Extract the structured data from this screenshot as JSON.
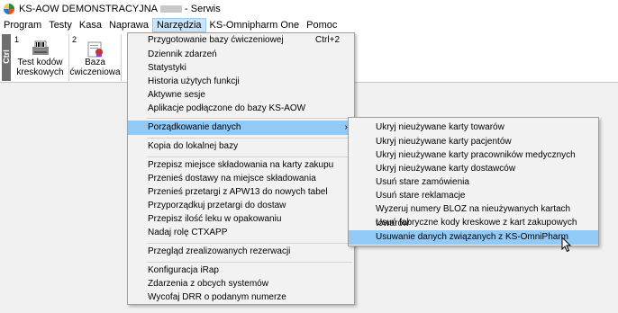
{
  "title": {
    "text_before": "KS-AOW DEMONSTRACYJNA",
    "text_after": "- Serwis"
  },
  "menubar": [
    "Program",
    "Testy",
    "Kasa",
    "Naprawa",
    "Narzędzia",
    "KS-Omnipharm One",
    "Pomoc"
  ],
  "toolbar": {
    "ctrl_label": "Ctrl",
    "buttons": [
      {
        "num": "1",
        "label_line1": "Test kodów",
        "label_line2": "kreskowych"
      },
      {
        "num": "2",
        "label_line1": "Baza",
        "label_line2": "ćwiczeniowa"
      }
    ]
  },
  "tools_menu": {
    "items": [
      {
        "label": "Przygotowanie bazy ćwiczeniowej",
        "shortcut": "Ctrl+2"
      },
      {
        "label": "Dziennik zdarzeń"
      },
      {
        "label": "Statystyki"
      },
      {
        "label": "Historia użytych funkcji"
      },
      {
        "label": "Aktywne sesje"
      },
      {
        "label": "Aplikacje podłączone do bazy KS-AOW"
      },
      {
        "label": "Porządkowanie danych",
        "arrow": "›"
      },
      {
        "label": "Kopia do lokalnej bazy"
      },
      {
        "label": "Przepisz miejsce składowania na karty zakupu"
      },
      {
        "label": "Przenieś dostawy na miejsce składowania"
      },
      {
        "label": "Przenieś przetargi z APW13 do nowych tabel"
      },
      {
        "label": "Przyporządkuj przetargi do dostaw"
      },
      {
        "label": "Przepisz ilość leku w opakowaniu"
      },
      {
        "label": "Nadaj rolę CTXAPP"
      },
      {
        "label": "Przegląd zrealizowanych rezerwacji"
      },
      {
        "label": "Konfiguracja iRap"
      },
      {
        "label": "Zdarzenia z obcych systemów"
      },
      {
        "label": "Wycofaj DRR o podanym numerze"
      }
    ]
  },
  "data_menu": {
    "items": [
      "Ukryj nieużywane karty towarów",
      "Ukryj nieużywane karty pacjentów",
      "Ukryj nieużywane karty pracowników medycznych",
      "Ukryj nieużywane karty dostawców",
      "Usuń stare zamówienia",
      "Usuń stare reklamacje",
      "Wyzeruj numery BLOZ na nieużywanych kartach towarów",
      "Usuń fabryczne kody kreskowe z kart zakupowych",
      "Usuwanie danych związanych z KS-OmniPharm"
    ]
  },
  "colors": {
    "highlight": "#91c9f7",
    "menu_bg": "#f2f2f2",
    "menubar_active": "#cce4f7"
  }
}
